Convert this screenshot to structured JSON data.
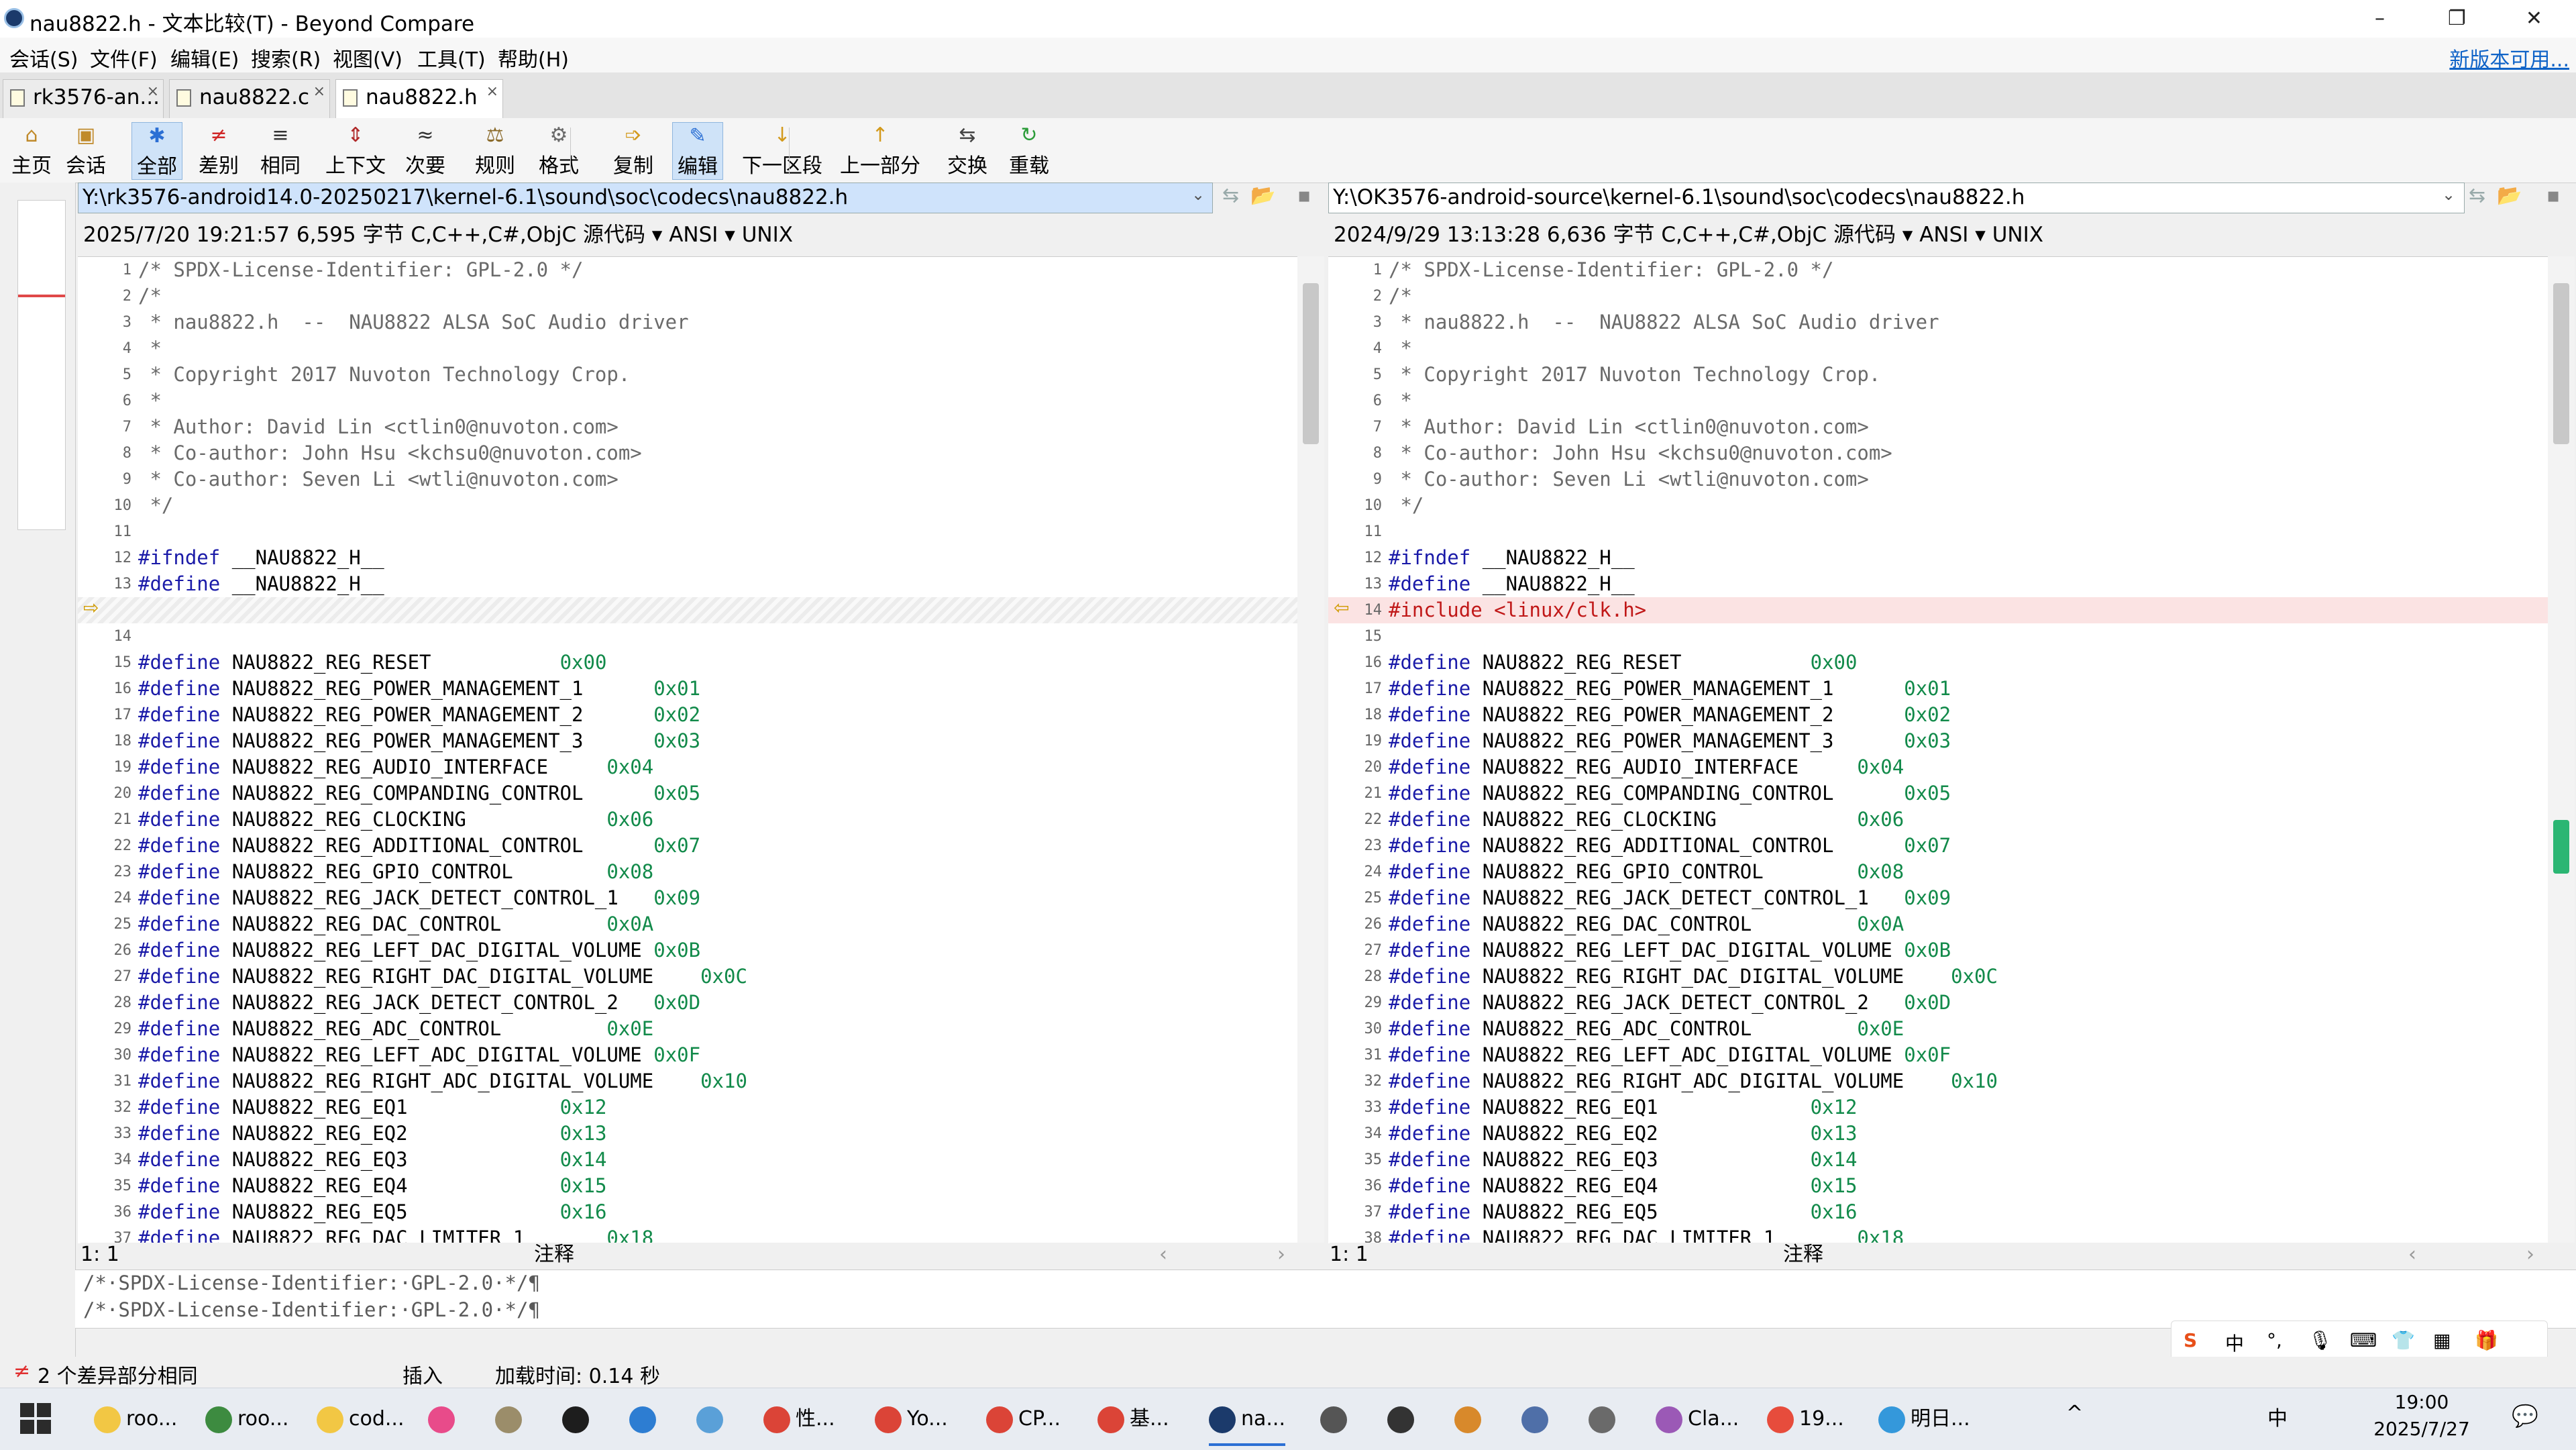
{
  "window": {
    "title": "nau8822.h - 文本比较(T) - Beyond Compare",
    "controls": [
      "–",
      "❐",
      "✕"
    ]
  },
  "menu": {
    "items": [
      "会话(S)",
      "文件(F)",
      "编辑(E)",
      "搜索(R)",
      "视图(V)",
      "工具(T)",
      "帮助(H)"
    ],
    "new_version": "新版本可用..."
  },
  "tabs": [
    {
      "label": "rk3576-an..."
    },
    {
      "label": "nau8822.c"
    },
    {
      "label": "nau8822.h",
      "active": true
    }
  ],
  "toolbar": [
    {
      "label": "主页",
      "icon": "home-icon"
    },
    {
      "label": "会话",
      "icon": "session-icon"
    },
    {
      "label": "全部",
      "icon": "all-icon",
      "selected": true
    },
    {
      "label": "差别",
      "icon": "diffs-icon"
    },
    {
      "label": "相同",
      "icon": "same-icon"
    },
    {
      "label": "上下文",
      "icon": "context-icon"
    },
    {
      "label": "次要",
      "icon": "minor-icon"
    },
    {
      "label": "规则",
      "icon": "rules-icon"
    },
    {
      "label": "格式",
      "icon": "format-icon"
    },
    {
      "label": "复制",
      "icon": "copy-icon"
    },
    {
      "label": "编辑",
      "icon": "edit-icon",
      "selected": true
    },
    {
      "label": "下一区段",
      "icon": "next-section-icon"
    },
    {
      "label": "上一部分",
      "icon": "prev-section-icon"
    },
    {
      "label": "交换",
      "icon": "swap-icon"
    },
    {
      "label": "重载",
      "icon": "reload-icon"
    }
  ],
  "left": {
    "path": "Y:\\rk3576-android14.0-20250217\\kernel-6.1\\sound\\soc\\codecs\\nau8822.h",
    "info": "2025/7/20 19:21:57  6,595 字节  C,C++,C#,ObjC 源代码 ▾ ANSI ▾ UNIX",
    "position": "1: 1",
    "mode": "注释"
  },
  "right": {
    "path": "Y:\\OK3576-android-source\\kernel-6.1\\sound\\soc\\codecs\\nau8822.h",
    "info": "2024/9/29 13:13:28  6,636 字节  C,C++,C#,ObjC 源代码 ▾ ANSI ▾ UNIX",
    "position": "1: 1",
    "mode": "注释"
  },
  "header_lines": [
    {
      "n": 1,
      "t": "/* SPDX-License-Identifier: GPL-2.0 */",
      "c": "cmt"
    },
    {
      "n": 2,
      "t": "/*",
      "c": "cmt"
    },
    {
      "n": 3,
      "t": " * nau8822.h  --  NAU8822 ALSA SoC Audio driver",
      "c": "cmt"
    },
    {
      "n": 4,
      "t": " *",
      "c": "cmt"
    },
    {
      "n": 5,
      "t": " * Copyright 2017 Nuvoton Technology Crop.",
      "c": "cmt"
    },
    {
      "n": 6,
      "t": " *",
      "c": "cmt"
    },
    {
      "n": 7,
      "t": " * Author: David Lin <ctlin0@nuvoton.com>",
      "c": "cmt"
    },
    {
      "n": 8,
      "t": " * Co-author: John Hsu <kchsu0@nuvoton.com>",
      "c": "cmt"
    },
    {
      "n": 9,
      "t": " * Co-author: Seven Li <wtli@nuvoton.com>",
      "c": "cmt"
    },
    {
      "n": 10,
      "t": " */",
      "c": "cmt"
    },
    {
      "n": 11,
      "t": "",
      "c": ""
    },
    {
      "n": 12,
      "t": "#ifndef __NAU8822_H__",
      "c": ""
    },
    {
      "n": 13,
      "t": "#define __NAU8822_H__",
      "c": ""
    }
  ],
  "diff_line": {
    "text": "#include <linux/clk.h>",
    "left_n": 14,
    "right_n": 14
  },
  "defines": [
    {
      "name": "NAU8822_REG_RESET",
      "val": "0x00",
      "pad": "           "
    },
    {
      "name": "NAU8822_REG_POWER_MANAGEMENT_1",
      "val": "0x01",
      "pad": "      "
    },
    {
      "name": "NAU8822_REG_POWER_MANAGEMENT_2",
      "val": "0x02",
      "pad": "      "
    },
    {
      "name": "NAU8822_REG_POWER_MANAGEMENT_3",
      "val": "0x03",
      "pad": "      "
    },
    {
      "name": "NAU8822_REG_AUDIO_INTERFACE",
      "val": "0x04",
      "pad": "     "
    },
    {
      "name": "NAU8822_REG_COMPANDING_CONTROL",
      "val": "0x05",
      "pad": "      "
    },
    {
      "name": "NAU8822_REG_CLOCKING",
      "val": "0x06",
      "pad": "            "
    },
    {
      "name": "NAU8822_REG_ADDITIONAL_CONTROL",
      "val": "0x07",
      "pad": "      "
    },
    {
      "name": "NAU8822_REG_GPIO_CONTROL",
      "val": "0x08",
      "pad": "        "
    },
    {
      "name": "NAU8822_REG_JACK_DETECT_CONTROL_1",
      "val": "0x09",
      "pad": "   "
    },
    {
      "name": "NAU8822_REG_DAC_CONTROL",
      "val": "0x0A",
      "pad": "         "
    },
    {
      "name": "NAU8822_REG_LEFT_DAC_DIGITAL_VOLUME",
      "val": "0x0B",
      "pad": " "
    },
    {
      "name": "NAU8822_REG_RIGHT_DAC_DIGITAL_VOLUME",
      "val": "0x0C",
      "pad": "    "
    },
    {
      "name": "NAU8822_REG_JACK_DETECT_CONTROL_2",
      "val": "0x0D",
      "pad": "   "
    },
    {
      "name": "NAU8822_REG_ADC_CONTROL",
      "val": "0x0E",
      "pad": "         "
    },
    {
      "name": "NAU8822_REG_LEFT_ADC_DIGITAL_VOLUME",
      "val": "0x0F",
      "pad": " "
    },
    {
      "name": "NAU8822_REG_RIGHT_ADC_DIGITAL_VOLUME",
      "val": "0x10",
      "pad": "    "
    },
    {
      "name": "NAU8822_REG_EQ1",
      "val": "0x12",
      "pad": "             "
    },
    {
      "name": "NAU8822_REG_EQ2",
      "val": "0x13",
      "pad": "             "
    },
    {
      "name": "NAU8822_REG_EQ3",
      "val": "0x14",
      "pad": "             "
    },
    {
      "name": "NAU8822_REG_EQ4",
      "val": "0x15",
      "pad": "             "
    },
    {
      "name": "NAU8822_REG_EQ5",
      "val": "0x16",
      "pad": "             "
    },
    {
      "name": "NAU8822_REG_DAC_LIMITER_1",
      "val": "0x18",
      "pad": "       "
    }
  ],
  "detail": {
    "line1": "/*·SPDX-License-Identifier:·GPL-2.0·*/¶",
    "line2": "/*·SPDX-License-Identifier:·GPL-2.0·*/¶"
  },
  "status": {
    "diffs": "2 个差异部分相同",
    "mode": "插入",
    "load_time": "加载时间: 0.14 秒"
  },
  "taskbar": {
    "items": [
      {
        "label": "roo...",
        "color": "#f2c744"
      },
      {
        "label": "roo...",
        "color": "#3d8b40"
      },
      {
        "label": "cod...",
        "color": "#f2c744"
      },
      {
        "label": "",
        "color": "#e84b8a"
      },
      {
        "label": "",
        "color": "#9b8d6a"
      },
      {
        "label": "",
        "color": "#1d1d1d"
      },
      {
        "label": "",
        "color": "#2d7dd2"
      },
      {
        "label": "",
        "color": "#5aa0d8"
      },
      {
        "label": "性...",
        "color": "#db4437"
      },
      {
        "label": "Yo...",
        "color": "#db4437"
      },
      {
        "label": "CP...",
        "color": "#db4437"
      },
      {
        "label": "基...",
        "color": "#db4437"
      },
      {
        "label": "na...",
        "color": "#1b3a6b",
        "active": true
      },
      {
        "label": "",
        "color": "#555555"
      },
      {
        "label": "",
        "color": "#333333"
      },
      {
        "label": "",
        "color": "#d8892b"
      },
      {
        "label": "",
        "color": "#4f6fa8"
      },
      {
        "label": "",
        "color": "#6a6a6a"
      },
      {
        "label": "Cla...",
        "color": "#9b59b6"
      },
      {
        "label": "19...",
        "color": "#e74c3c"
      },
      {
        "label": "明日...",
        "color": "#3498db"
      }
    ],
    "tray": [
      "^",
      "中"
    ],
    "time": "19:00",
    "date": "2025/7/27"
  },
  "ime": [
    "S",
    "中",
    "°,",
    "🎙",
    "⌨",
    "👕",
    "▦",
    "🎁"
  ]
}
